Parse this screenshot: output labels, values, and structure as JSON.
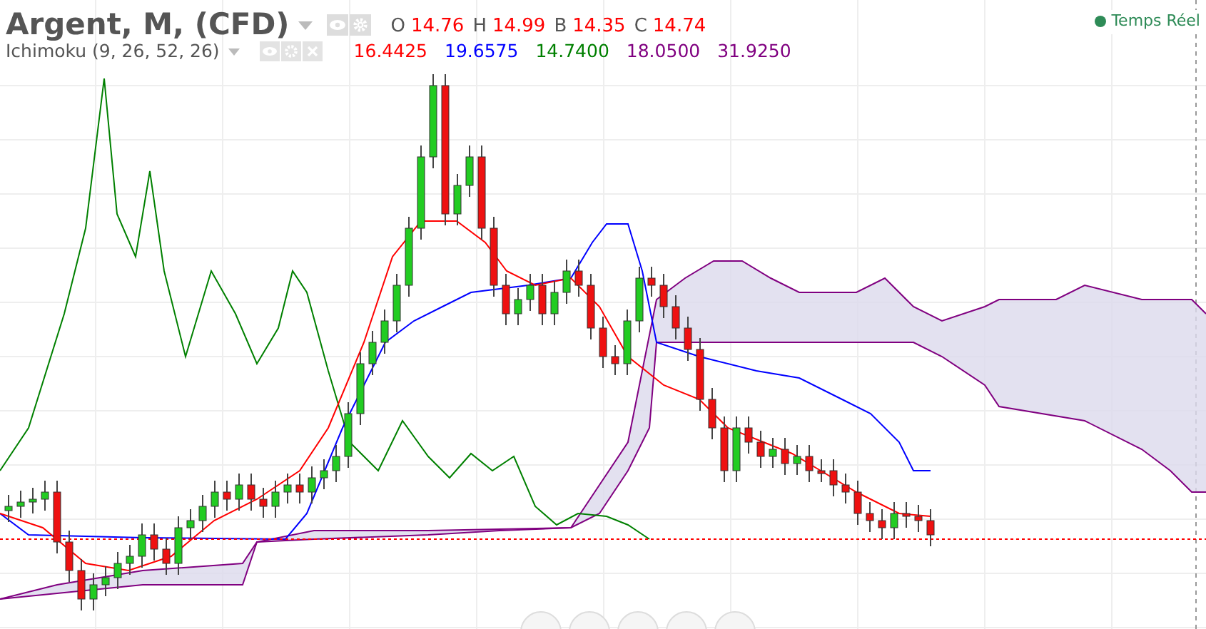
{
  "symbol": {
    "title": "Argent, M, (CFD)",
    "ohlc": [
      {
        "label": "O",
        "value": "14.76"
      },
      {
        "label": "H",
        "value": "14.99"
      },
      {
        "label": "B",
        "value": "14.35"
      },
      {
        "label": "C",
        "value": "14.74"
      }
    ]
  },
  "indicator": {
    "title": "Ichimoku (9, 26, 52, 26)",
    "values": [
      {
        "value": "16.4425",
        "color": "#ff0000"
      },
      {
        "value": "19.6575",
        "color": "#0000ff"
      },
      {
        "value": "14.7400",
        "color": "#008000"
      },
      {
        "value": "18.0500",
        "color": "#800080"
      },
      {
        "value": "31.9250",
        "color": "#800080"
      }
    ]
  },
  "status": {
    "label": "Temps Réel"
  }
}
